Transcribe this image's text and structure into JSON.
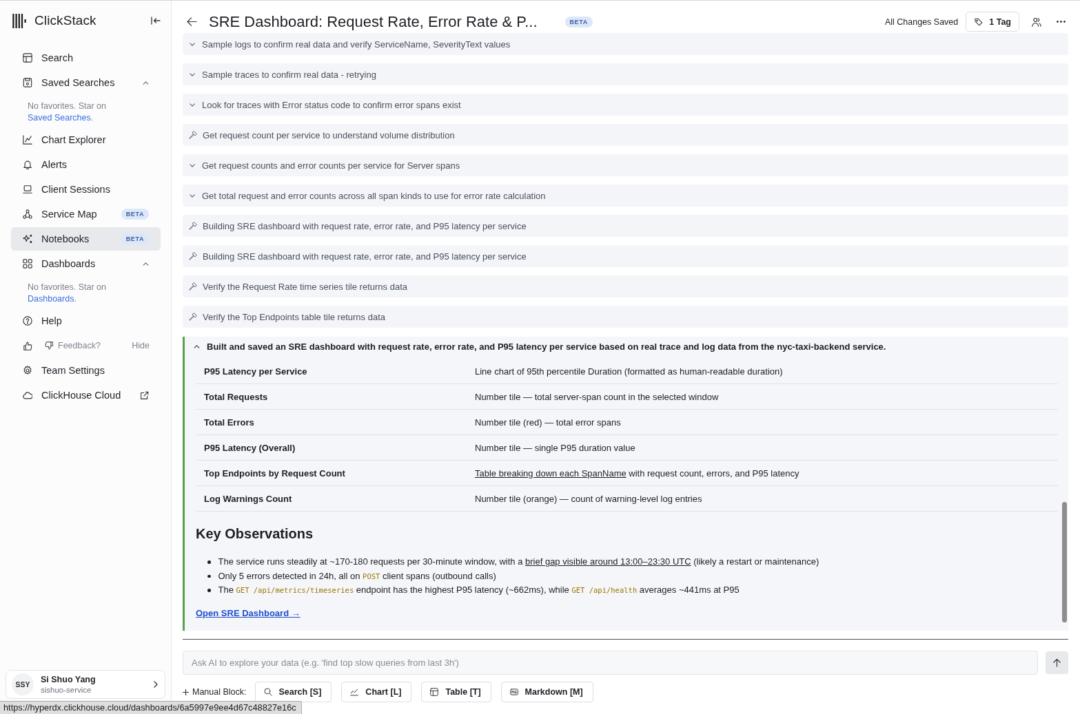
{
  "header": {
    "title": "SRE Dashboard: Request Rate, Error Rate & P...",
    "badge": "BETA",
    "save_status": "All Changes Saved",
    "tag_button": "1 Tag"
  },
  "sidebar": {
    "logo": "ClickStack",
    "items": [
      {
        "kind": "nav",
        "label": "Search",
        "selected": false
      },
      {
        "kind": "nav",
        "label": "Saved Searches",
        "selected": false,
        "expanded": true
      },
      {
        "kind": "note",
        "text": "No favorites. Star on ",
        "link": "Saved Searches",
        "end": "."
      },
      {
        "kind": "nav",
        "label": "Chart Explorer",
        "selected": false
      },
      {
        "kind": "nav",
        "label": "Alerts",
        "selected": false
      },
      {
        "kind": "nav",
        "label": "Client Sessions",
        "selected": false
      },
      {
        "kind": "nav",
        "label": "Service Map",
        "selected": false,
        "badge": "BETA"
      },
      {
        "kind": "nav",
        "label": "Notebooks",
        "selected": true,
        "badge": "BETA"
      },
      {
        "kind": "nav",
        "label": "Dashboards",
        "selected": false,
        "expanded": true
      },
      {
        "kind": "note",
        "text": "No favorites. Star on ",
        "link": "Dashboards",
        "end": "."
      },
      {
        "kind": "nav",
        "label": "Help",
        "selected": false
      },
      {
        "kind": "feedback",
        "label": "Feedback?",
        "action": "Hide"
      },
      {
        "kind": "nav",
        "label": "Team Settings",
        "selected": false
      },
      {
        "kind": "nav",
        "label": "ClickHouse Cloud",
        "selected": false,
        "external": true
      }
    ],
    "user": {
      "initials": "SSY",
      "name": "Si Shuo Yang",
      "subtitle": "sishuo-service"
    }
  },
  "steps": [
    {
      "kind": "group",
      "text": "Sample logs to confirm real data and verify ServiceName, SeverityText values"
    },
    {
      "kind": "group",
      "text": "Sample traces to confirm real data - retrying"
    },
    {
      "kind": "group",
      "text": "Look for traces with Error status code to confirm error spans exist"
    },
    {
      "kind": "tool",
      "text": "Get request count per service to understand volume distribution"
    },
    {
      "kind": "group",
      "text": "Get request counts and error counts per service for Server spans"
    },
    {
      "kind": "group",
      "text": "Get total request and error counts across all span kinds to use for error rate calculation"
    },
    {
      "kind": "tool",
      "text": "Building SRE dashboard with request rate, error rate, and P95 latency per service"
    },
    {
      "kind": "tool",
      "text": "Building SRE dashboard with request rate, error rate, and P95 latency per service"
    },
    {
      "kind": "tool",
      "text": "Verify the Request Rate time series tile returns data"
    },
    {
      "kind": "tool",
      "text": "Verify the Top Endpoints table tile returns data"
    }
  ],
  "summary": {
    "expanded": true,
    "title": "Built and saved an SRE dashboard with request rate, error rate, and P95 latency per service based on real trace and log data from the nyc-taxi-backend service.",
    "table": {
      "rows": [
        {
          "name": "P95 Latency per Service",
          "description": [
            {
              "kind": "text",
              "text": "Line chart of 95th percentile Duration (formatted as human-readable duration)"
            }
          ]
        },
        {
          "name": "Total Requests",
          "description": [
            {
              "kind": "text",
              "text": "Number tile — total server-span count in the selected window"
            }
          ]
        },
        {
          "name": "Total Errors",
          "description": [
            {
              "kind": "text",
              "text": "Number tile (red) — total error spans"
            }
          ]
        },
        {
          "name": "P95 Latency (Overall)",
          "description": [
            {
              "kind": "text",
              "text": "Number tile — single P95 duration value"
            }
          ]
        },
        {
          "name": "Top Endpoints by Request Count",
          "description": [
            {
              "kind": "link",
              "text": "Table breaking down each SpanName"
            },
            {
              "kind": "text",
              "text": " with request count, errors, and P95 latency"
            }
          ]
        },
        {
          "name": "Log Warnings Count",
          "description": [
            {
              "kind": "text",
              "text": "Number tile (orange) — count of warning-level log entries"
            }
          ]
        }
      ]
    },
    "heading": "Key Observations",
    "bullets": [
      [
        {
          "kind": "text",
          "text": "The service runs steadily at ~170-180 requests per 30-minute window, with a "
        },
        {
          "kind": "link",
          "text": "brief gap visible around 13:00–23:30 UTC"
        },
        {
          "kind": "text",
          "text": " (likely a restart or maintenance)"
        }
      ],
      [
        {
          "kind": "text",
          "text": "Only 5 errors detected in 24h, all on "
        },
        {
          "kind": "code",
          "text": "POST"
        },
        {
          "kind": "text",
          "text": " client spans (outbound calls)"
        }
      ],
      [
        {
          "kind": "text",
          "text": "The "
        },
        {
          "kind": "code",
          "text": "GET /api/metrics/timeseries"
        },
        {
          "kind": "text",
          "text": " endpoint has the highest P95 latency (~662ms), while "
        },
        {
          "kind": "code",
          "text": "GET /api/health"
        },
        {
          "kind": "text",
          "text": " averages ~441ms at P95"
        }
      ]
    ],
    "link": "Open SRE Dashboard →"
  },
  "composer": {
    "placeholder": "Ask AI to explore your data (e.g. 'find top slow queries from last 3h')",
    "manual_label": "Manual Block:",
    "blocks": [
      "Search [S]",
      "Chart [L]",
      "Table [T]",
      "Markdown [M]"
    ]
  },
  "status_url": "https://hyperdx.clickhouse.cloud/dashboards/6a5997e9ee4d67c48827e16c"
}
